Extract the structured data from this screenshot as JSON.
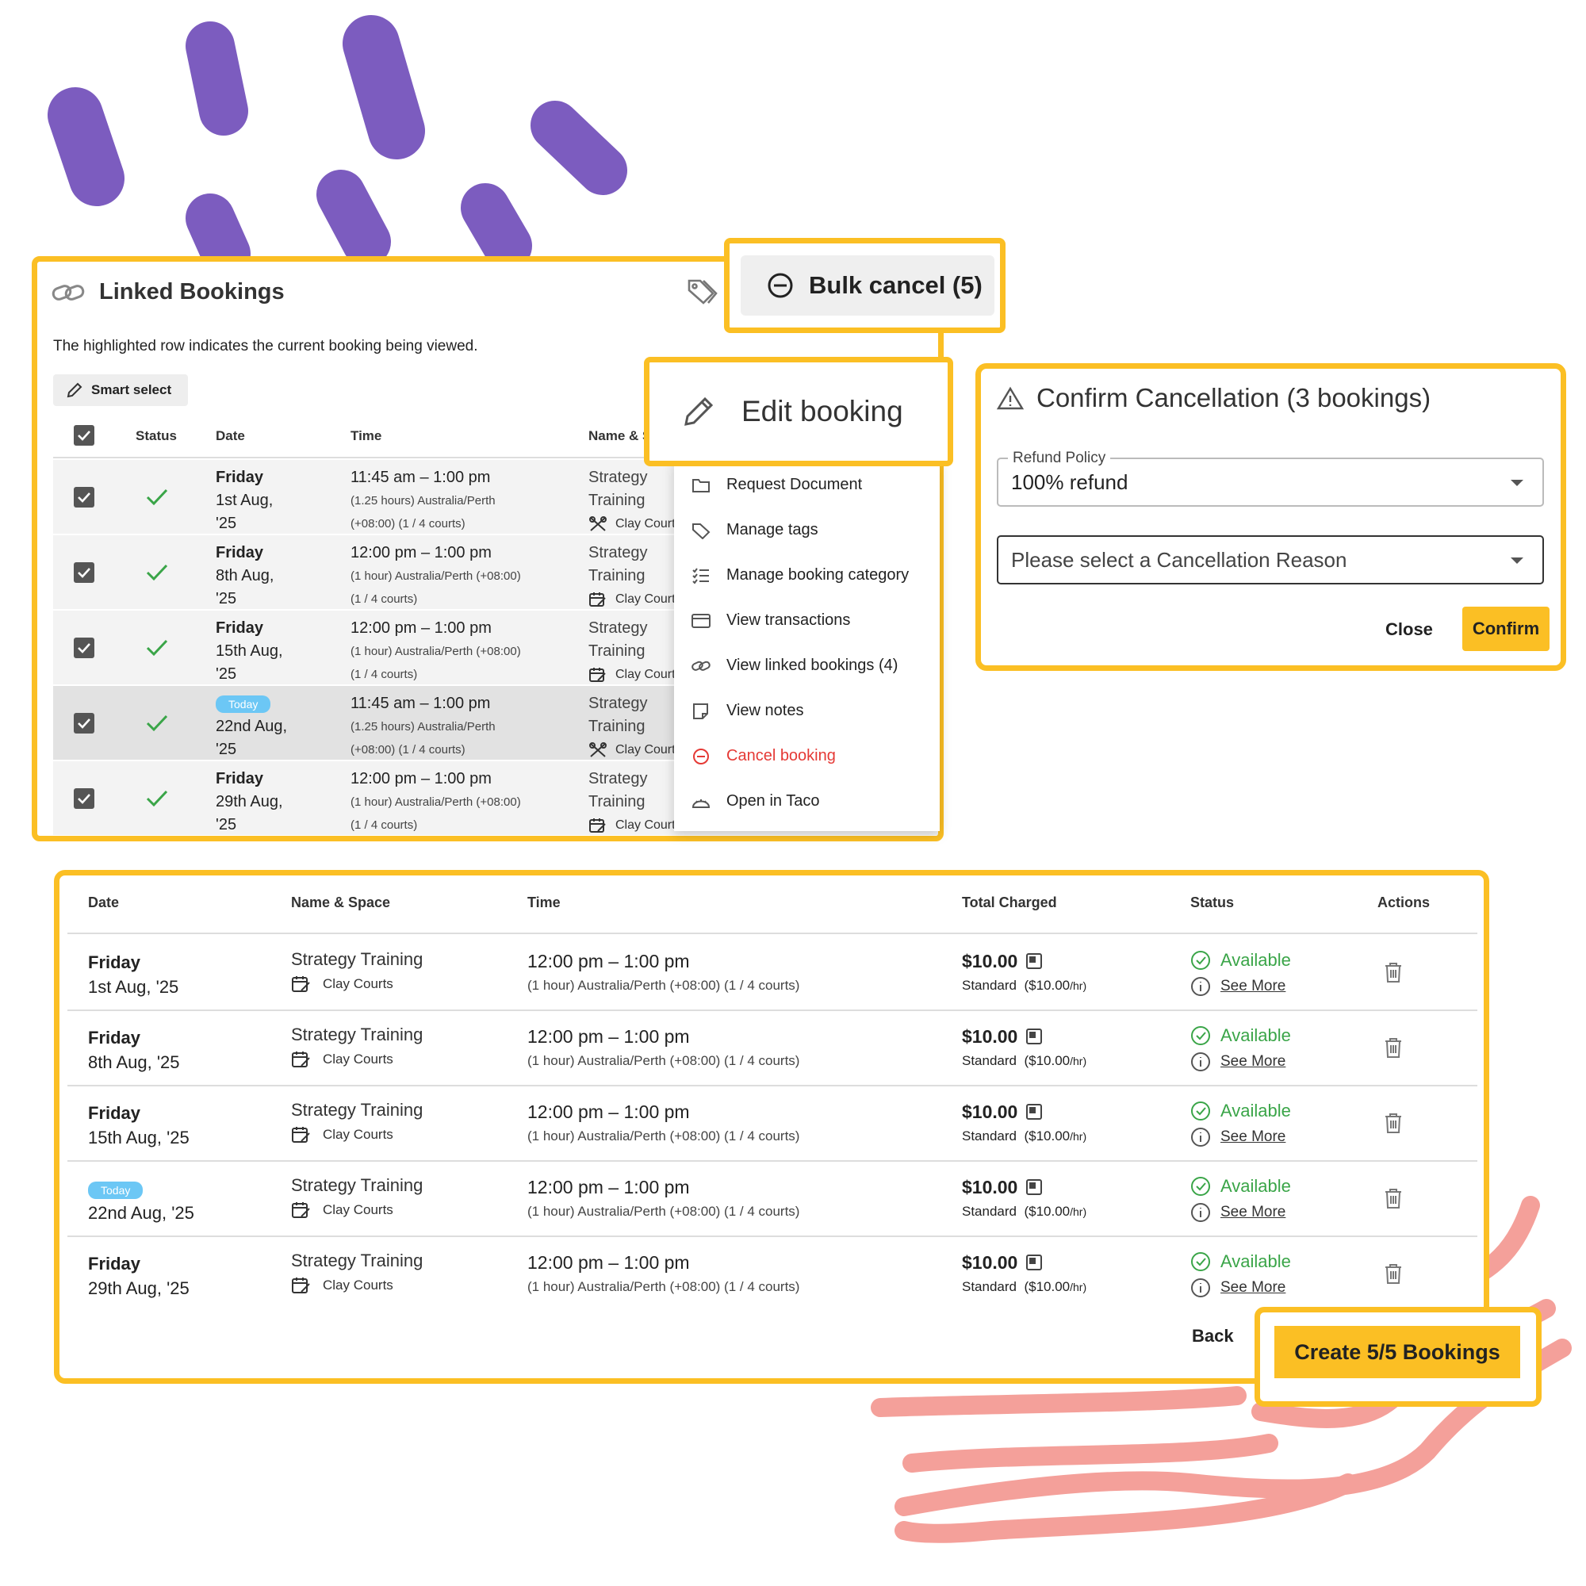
{
  "colors": {
    "accent": "#fbbf24",
    "purple": "#7c5cbf",
    "coral": "#f4a09a",
    "success": "#3aa548",
    "danger": "#e53935",
    "today": "#6cc7f5"
  },
  "linked": {
    "title": "Linked Bookings",
    "hint": "The highlighted row indicates the current booking being viewed.",
    "smart_select": "Smart select",
    "headers": {
      "status": "Status",
      "date": "Date",
      "time": "Time",
      "name": "Name & Spa"
    },
    "rows": [
      {
        "day": "Friday",
        "date": "1st Aug,",
        "year": "'25",
        "time": "11:45 am – 1:00 pm",
        "sub1": "(1.25 hours) Australia/Perth",
        "sub2": "(+08:00) (1 / 4 courts)",
        "name1": "Strategy",
        "name2": "Training",
        "space": "Clay Courts"
      },
      {
        "day": "Friday",
        "date": "8th Aug,",
        "year": "'25",
        "time": "12:00 pm – 1:00 pm",
        "sub1": "(1 hour) Australia/Perth (+08:00)",
        "sub2": "(1 / 4 courts)",
        "name1": "Strategy",
        "name2": "Training",
        "space": "Clay Courts"
      },
      {
        "day": "Friday",
        "date": "15th Aug,",
        "year": "'25",
        "time": "12:00 pm – 1:00 pm",
        "sub1": "(1 hour) Australia/Perth (+08:00)",
        "sub2": "(1 / 4 courts)",
        "name1": "Strategy",
        "name2": "Training",
        "space": "Clay Courts"
      },
      {
        "day": "Today",
        "date": "22nd Aug,",
        "year": "'25",
        "time": "11:45 am – 1:00 pm",
        "sub1": "(1.25 hours) Australia/Perth",
        "sub2": "(+08:00) (1 / 4 courts)",
        "name1": "Strategy",
        "name2": "Training",
        "space": "Clay Courts"
      },
      {
        "day": "Friday",
        "date": "29th Aug,",
        "year": "'25",
        "time": "12:00 pm – 1:00 pm",
        "sub1": "(1 hour) Australia/Perth (+08:00)",
        "sub2": "(1 / 4 courts)",
        "name1": "Strategy",
        "name2": "Training",
        "space": "Clay Courts"
      }
    ]
  },
  "bulk_cancel": {
    "label": "Bulk cancel (5)"
  },
  "edit_booking": {
    "label": "Edit booking"
  },
  "menu": {
    "items": [
      {
        "label": "Request Document",
        "icon": "folder-icon"
      },
      {
        "label": "Manage tags",
        "icon": "tag-icon"
      },
      {
        "label": "Manage booking category",
        "icon": "list-check-icon"
      },
      {
        "label": "View transactions",
        "icon": "card-icon"
      },
      {
        "label": "View linked bookings (4)",
        "icon": "link-icon"
      },
      {
        "label": "View notes",
        "icon": "note-icon"
      },
      {
        "label": "Cancel booking",
        "icon": "minus-circle-icon"
      },
      {
        "label": "Open in Taco",
        "icon": "taco-icon"
      }
    ]
  },
  "confirm": {
    "title": "Confirm Cancellation (3 bookings)",
    "refund_label": "Refund Policy",
    "refund_value": "100% refund",
    "reason_placeholder": "Please select a Cancellation Reason",
    "close": "Close",
    "confirm": "Confirm"
  },
  "bottom": {
    "headers": {
      "date": "Date",
      "name": "Name & Space",
      "time": "Time",
      "total": "Total Charged",
      "status": "Status",
      "actions": "Actions"
    },
    "rows": [
      {
        "day": "Friday",
        "date": "1st Aug, '25",
        "name": "Strategy Training",
        "space": "Clay Courts",
        "time": "12:00 pm – 1:00 pm",
        "sub": "(1 hour) Australia/Perth (+08:00) (1 / 4 courts)",
        "price": "$10.00",
        "rate_label": "Standard",
        "rate": "($10.00",
        "rate_unit": "/hr)",
        "status": "Available",
        "see_more": "See More"
      },
      {
        "day": "Friday",
        "date": "8th Aug, '25",
        "name": "Strategy Training",
        "space": "Clay Courts",
        "time": "12:00 pm – 1:00 pm",
        "sub": "(1 hour) Australia/Perth (+08:00) (1 / 4 courts)",
        "price": "$10.00",
        "rate_label": "Standard",
        "rate": "($10.00",
        "rate_unit": "/hr)",
        "status": "Available",
        "see_more": "See More"
      },
      {
        "day": "Friday",
        "date": "15th Aug, '25",
        "name": "Strategy Training",
        "space": "Clay Courts",
        "time": "12:00 pm – 1:00 pm",
        "sub": "(1 hour) Australia/Perth (+08:00) (1 / 4 courts)",
        "price": "$10.00",
        "rate_label": "Standard",
        "rate": "($10.00",
        "rate_unit": "/hr)",
        "status": "Available",
        "see_more": "See More"
      },
      {
        "day": "Today",
        "date": "22nd Aug, '25",
        "name": "Strategy Training",
        "space": "Clay Courts",
        "time": "12:00 pm – 1:00 pm",
        "sub": "(1 hour) Australia/Perth (+08:00) (1 / 4 courts)",
        "price": "$10.00",
        "rate_label": "Standard",
        "rate": "($10.00",
        "rate_unit": "/hr)",
        "status": "Available",
        "see_more": "See More"
      },
      {
        "day": "Friday",
        "date": "29th Aug, '25",
        "name": "Strategy Training",
        "space": "Clay Courts",
        "time": "12:00 pm – 1:00 pm",
        "sub": "(1 hour) Australia/Perth (+08:00) (1 / 4 courts)",
        "price": "$10.00",
        "rate_label": "Standard",
        "rate": "($10.00",
        "rate_unit": "/hr)",
        "status": "Available",
        "see_more": "See More"
      }
    ],
    "back": "Back",
    "create": "Create 5/5 Bookings"
  }
}
